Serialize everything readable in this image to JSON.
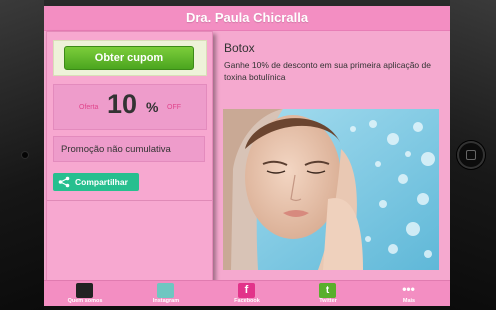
{
  "header": {
    "title": "Dra. Paula Chicralla"
  },
  "coupon": {
    "button_label": "Obter cupom",
    "offer_label": "Oferta",
    "offer_value": "10",
    "offer_percent": "%",
    "offer_off": "OFF",
    "promo_text": "Promoção não cumulativa",
    "share_label": "Compartilhar"
  },
  "deal": {
    "title": "Botox",
    "description": "Ganhe 10% de desconto em sua primeira aplicação de toxina botulínica"
  },
  "nav": {
    "items": [
      {
        "label": "Quem somos",
        "icon": "quem-somos-icon",
        "color": "#222222"
      },
      {
        "label": "Instagram",
        "icon": "instagram-icon",
        "color": "#6fc6c1"
      },
      {
        "label": "Facebook",
        "icon": "facebook-icon",
        "color": "#e2338a"
      },
      {
        "label": "Twitter",
        "icon": "twitter-icon",
        "color": "#5aaf2c"
      },
      {
        "label": "Mais",
        "icon": "more-icon",
        "color": "#ffffff"
      }
    ]
  },
  "colors": {
    "background": "#f5a9cf",
    "header": "#f38ec2",
    "coupon_button": "#4ba51f",
    "share_button": "#27bf8f"
  }
}
